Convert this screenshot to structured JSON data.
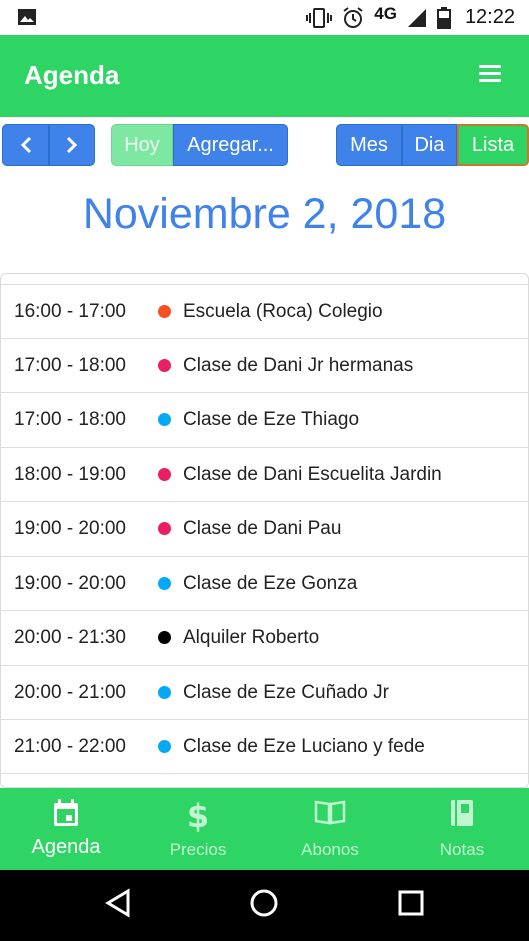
{
  "status_bar": {
    "network": "4G",
    "time": "12:22"
  },
  "app_bar": {
    "title": "Agenda"
  },
  "toolbar": {
    "prev": "<",
    "next": ">",
    "today": "Hoy",
    "add": "Agregar...",
    "views": [
      "Mes",
      "Dia",
      "Lista"
    ],
    "active_view": "Lista"
  },
  "date_title": "Noviembre 2, 2018",
  "events": [
    {
      "time": "16:00 - 17:00",
      "title": "Escuela (Roca) Colegio",
      "color": "#f4511e"
    },
    {
      "time": "17:00 - 18:00",
      "title": "Clase de Dani Jr hermanas",
      "color": "#e91e63"
    },
    {
      "time": "17:00 - 18:00",
      "title": "Clase de Eze Thiago",
      "color": "#03a9f4"
    },
    {
      "time": "18:00 - 19:00",
      "title": "Clase de Dani Escuelita Jardin",
      "color": "#e91e63"
    },
    {
      "time": "19:00 - 20:00",
      "title": "Clase de Dani Pau",
      "color": "#e91e63"
    },
    {
      "time": "19:00 - 20:00",
      "title": "Clase de Eze Gonza",
      "color": "#03a9f4"
    },
    {
      "time": "20:00 - 21:30",
      "title": "Alquiler Roberto",
      "color": "#000000"
    },
    {
      "time": "20:00 - 21:00",
      "title": "Clase de Eze Cuñado Jr",
      "color": "#03a9f4"
    },
    {
      "time": "21:00 - 22:00",
      "title": "Clase de Eze Luciano y fede",
      "color": "#03a9f4"
    }
  ],
  "bottom_nav": [
    {
      "label": "Agenda",
      "icon": "calendar-icon",
      "active": true
    },
    {
      "label": "Precios",
      "icon": "dollar-icon",
      "active": false
    },
    {
      "label": "Abonos",
      "icon": "book-open-icon",
      "active": false
    },
    {
      "label": "Notas",
      "icon": "notebook-icon",
      "active": false
    }
  ],
  "colors": {
    "primary_green": "#2ed565",
    "accent_blue": "#3e82ea"
  }
}
